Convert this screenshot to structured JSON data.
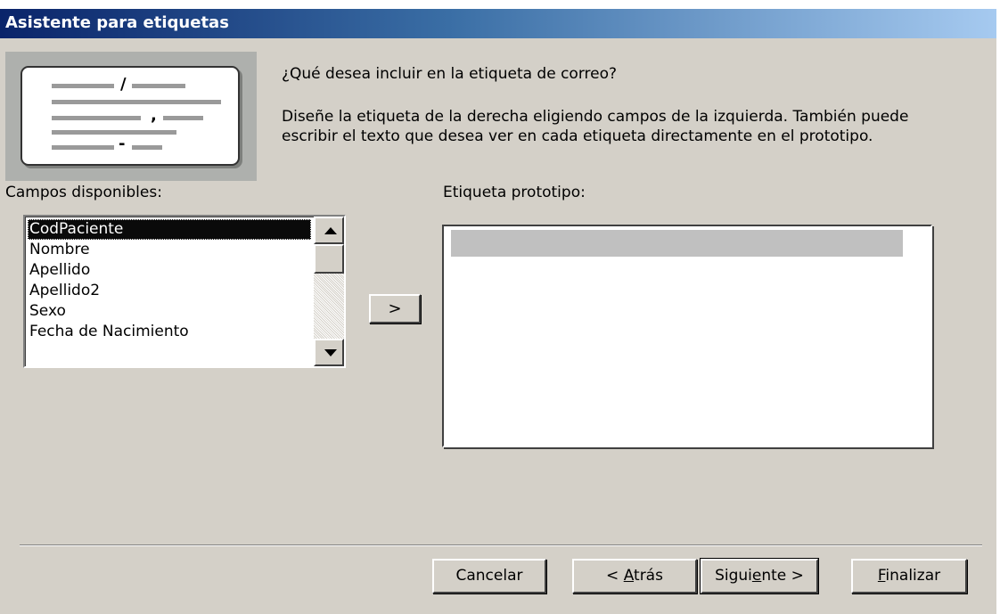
{
  "window": {
    "title": "Asistente para etiquetas"
  },
  "illustration": {
    "glyphs": [
      "/",
      ",",
      "-"
    ]
  },
  "heading": "¿Qué desea incluir en la etiqueta de correo?",
  "description": "Diseñe la etiqueta de la derecha eligiendo campos de la izquierda. También puede escribir el texto que desea ver en cada etiqueta directamente en el prototipo.",
  "fields": {
    "label": "Campos disponibles:",
    "items": [
      "CodPaciente",
      "Nombre",
      "Apellido",
      "Apellido2",
      "Sexo",
      "Fecha de Nacimiento"
    ],
    "selected_index": 0,
    "scroll_position": 0
  },
  "add_button": ">",
  "prototype": {
    "label": "Etiqueta prototipo:"
  },
  "buttons": {
    "cancel": "Cancelar",
    "back_prefix": "< ",
    "back_mnemonic": "A",
    "back_rest": "trás",
    "next_prefix": "Sigui",
    "next_mnemonic": "e",
    "next_rest": "nte >",
    "finish_mnemonic": "F",
    "finish_rest": "inalizar"
  },
  "colors": {
    "title_start": "#0a246a",
    "title_end": "#a6caf0",
    "face": "#d4d0c8",
    "selection": "#0a0a0a"
  }
}
